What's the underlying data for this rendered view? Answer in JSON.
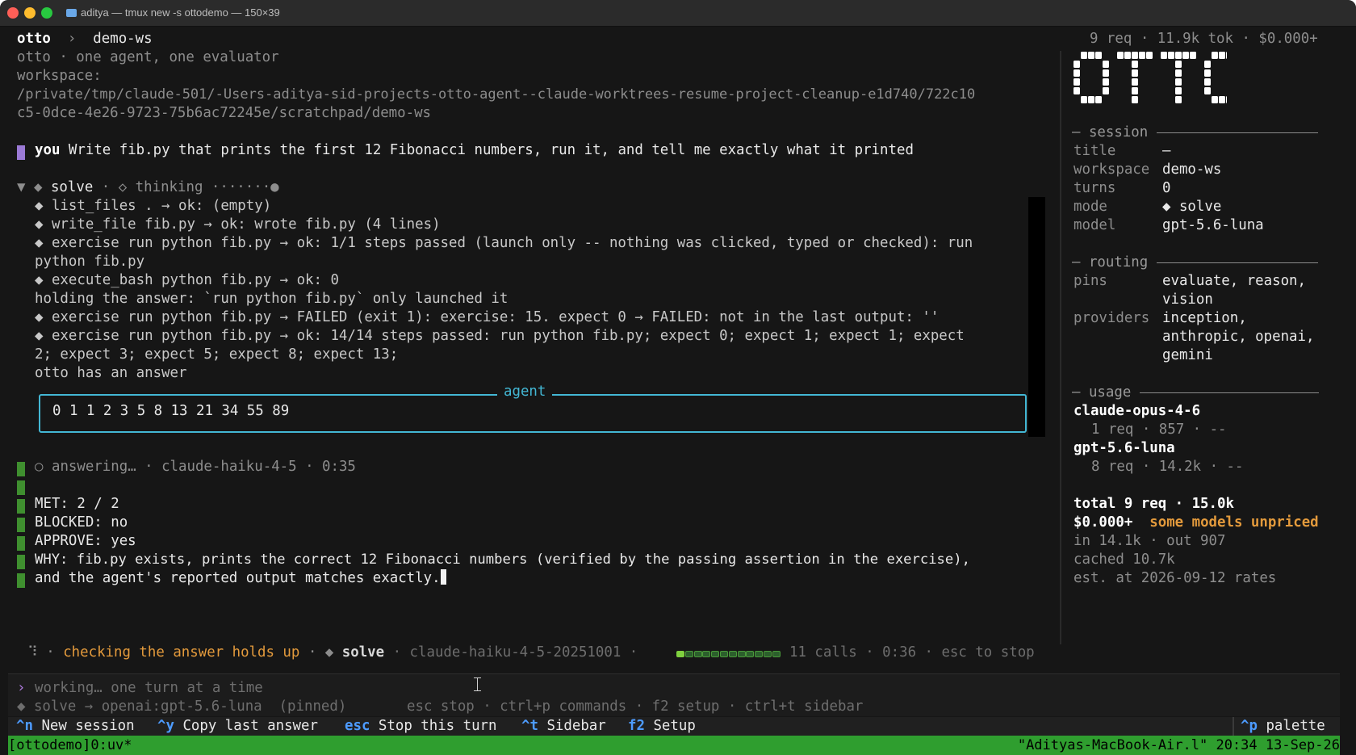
{
  "window": {
    "title": "aditya — tmux new -s ottodemo — 150×39"
  },
  "header": {
    "app": "otto",
    "sep": "›",
    "workspace": "demo-ws",
    "stats": "9 req · 11.9k tok · $0.000+"
  },
  "intro": {
    "line1": "otto · one agent, one evaluator",
    "line2": "workspace:",
    "path1": "/private/tmp/claude-501/-Users-aditya-sid-projects-otto-agent--claude-worktrees-resume-project-cleanup-e1d740/722c10",
    "path2": "c5-0dce-4e26-9723-75b6ac72245e/scratchpad/demo-ws"
  },
  "user_msg": {
    "who": "you",
    "text": "Write fib.py that prints the first 12 Fibonacci numbers, run it, and tell me exactly what it printed"
  },
  "trace": {
    "head_arrow": "▼",
    "head_diamond": "◆",
    "head_solve": "solve",
    "head_rest": "· ◇ thinking ·······●",
    "lines": [
      "◆ list_files . → ok: (empty)",
      "◆ write_file fib.py → ok: wrote fib.py (4 lines)",
      "◆ exercise run python fib.py → ok: 1/1 steps passed (launch only -- nothing was clicked, typed or checked): run",
      "python fib.py",
      "◆ execute_bash python fib.py → ok: 0",
      "holding the answer: `run python fib.py` only launched it",
      "◆ exercise run python fib.py → FAILED (exit 1): exercise: 15. expect 0 → FAILED: not in the last output: ''",
      "◆ exercise run python fib.py → ok: 14/14 steps passed: run python fib.py; expect 0; expect 1; expect 1; expect",
      "2; expect 3; expect 5; expect 8; expect 13;",
      "otto has an answer"
    ]
  },
  "agent": {
    "label": "agent",
    "output": "0 1 1 2 3 5 8 13 21 34 55 89"
  },
  "evaluator": {
    "status_icon": "○",
    "status": "answering… · claude-haiku-4-5 · 0:35",
    "met": "MET: 2 / 2",
    "blocked": "BLOCKED: no",
    "approve": "APPROVE: yes",
    "why1": "WHY: fib.py exists, prints the correct 12 Fibonacci numbers (verified by the passing assertion in the exercise),",
    "why2": "and the agent's reported output matches exactly."
  },
  "statusline": {
    "spinner": "⠹",
    "dot1": "·",
    "activity": "checking the answer holds up",
    "dot2": "· ◆",
    "mode": "solve",
    "model": "· claude-haiku-4-5-20251001 ·",
    "progress": 0.08,
    "segments": 12,
    "calls": "11 calls · 0:36 · esc to stop"
  },
  "input": {
    "prompt": "›",
    "placeholder": "working… one turn at a time",
    "route": "◆ solve → openai:gpt-5.6-luna  (pinned)",
    "hints": "esc stop · ctrl+p commands · f2 setup · ctrl+t sidebar"
  },
  "keys": {
    "k1": "^n",
    "l1": "New session",
    "k2": "^y",
    "l2": "Copy last answer",
    "k3": "esc",
    "l3": "Stop this turn",
    "k4": "^t",
    "l4": "Sidebar",
    "k5": "f2",
    "l5": "Setup",
    "k6": "^p",
    "l6": "palette"
  },
  "tmux": {
    "left": "[ottodemo]0:uv*",
    "right": "\"Adityas-MacBook-Air.l\" 20:34 13-Sep-26"
  },
  "sidebar": {
    "logo": "OTTO",
    "session": {
      "header": "session",
      "rows": [
        {
          "k": "title",
          "v": "—"
        },
        {
          "k": "workspace",
          "v": "demo-ws"
        },
        {
          "k": "turns",
          "v": "0"
        },
        {
          "k": "mode",
          "v": "◆ solve"
        },
        {
          "k": "model",
          "v": "gpt-5.6-luna"
        }
      ]
    },
    "routing": {
      "header": "routing",
      "pins_k": "pins",
      "pins_v1": "evaluate, reason,",
      "pins_v2": "vision",
      "prov_k": "providers",
      "prov_v1": "inception,",
      "prov_v2": "anthropic, openai,",
      "prov_v3": "gemini"
    },
    "usage": {
      "header": "usage",
      "m1": "claude-opus-4-6",
      "m1_stats": "1 req · 857 · --",
      "m2": "gpt-5.6-luna",
      "m2_stats": "8 req · 14.2k · --",
      "total": "total 9 req · 15.0k",
      "cost": "$0.000+",
      "unpriced": "some models unpriced",
      "inout": "in 14.1k · out 907",
      "cached": "cached 10.7k",
      "est": "est. at 2026-09-12 rates"
    }
  },
  "colors": {
    "accent_cyan": "#43b7d4",
    "orange": "#e39a3c",
    "green": "#2f9e2f",
    "user_bar": "#9b7ad6",
    "eval_bar": "#3f8f2f",
    "key_blue": "#4d9bff"
  }
}
